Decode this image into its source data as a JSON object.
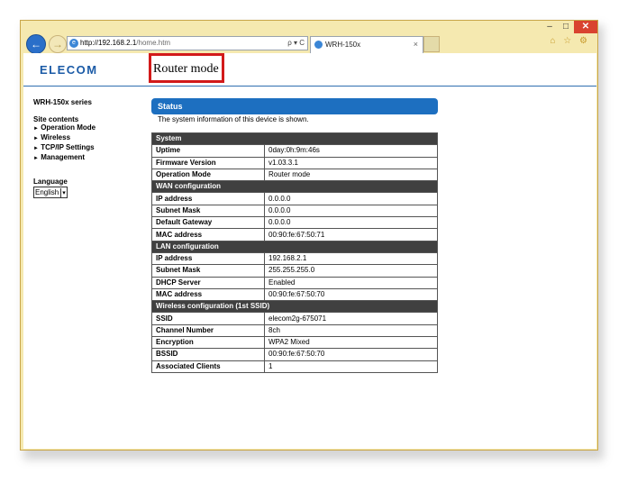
{
  "window": {
    "controls": {
      "minimize": "–",
      "maximize": "□",
      "close": "✕"
    }
  },
  "browser": {
    "address_host": "http://192.168.2.1",
    "address_path": "/home.htm",
    "address_tools": "ρ ▾ C",
    "tab_title": "WRH-150x",
    "tab_close": "×",
    "right_icons": "⌂ ☆ ⚙"
  },
  "page": {
    "logo": "ELECOM",
    "mode_label": "Router mode",
    "sidebar": {
      "series": "WRH-150x series",
      "site_contents": "Site contents",
      "menu": [
        "Operation Mode",
        "Wireless",
        "TCP/IP Settings",
        "Management"
      ],
      "language_label": "Language",
      "language_value": "English"
    },
    "status": {
      "title": "Status",
      "description": "The system information of this device is shown."
    },
    "sections": [
      {
        "title": "System",
        "rows": [
          {
            "key": "Uptime",
            "value": "0day:0h:9m:46s"
          },
          {
            "key": "Firmware Version",
            "value": "v1.03.3.1"
          },
          {
            "key": "Operation Mode",
            "value": "Router mode"
          }
        ]
      },
      {
        "title": "WAN configuration",
        "rows": [
          {
            "key": "IP address",
            "value": "0.0.0.0"
          },
          {
            "key": "Subnet Mask",
            "value": "0.0.0.0"
          },
          {
            "key": "Default Gateway",
            "value": "0.0.0.0"
          },
          {
            "key": "MAC address",
            "value": "00:90:fe:67:50:71"
          }
        ]
      },
      {
        "title": "LAN configuration",
        "rows": [
          {
            "key": "IP address",
            "value": "192.168.2.1"
          },
          {
            "key": "Subnet Mask",
            "value": "255.255.255.0"
          },
          {
            "key": "DHCP Server",
            "value": "Enabled"
          },
          {
            "key": "MAC address",
            "value": "00:90:fe:67:50:70"
          }
        ]
      },
      {
        "title": "Wireless configuration (1st SSID)",
        "rows": [
          {
            "key": "SSID",
            "value": "elecom2g-675071"
          },
          {
            "key": "Channel Number",
            "value": "8ch"
          },
          {
            "key": "Encryption",
            "value": "WPA2 Mixed"
          },
          {
            "key": "BSSID",
            "value": "00:90:fe:67:50:70"
          },
          {
            "key": "Associated Clients",
            "value": "1"
          }
        ]
      }
    ]
  }
}
